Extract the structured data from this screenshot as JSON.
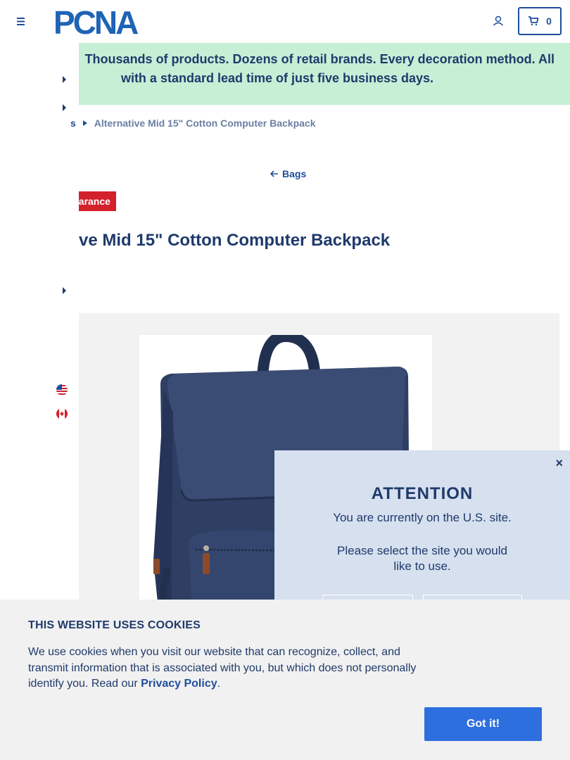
{
  "header": {
    "logo_text": "PCNA",
    "cart_count": "0"
  },
  "banner": {
    "line1": "Thousands of products. Dozens of retail brands. Every decoration method. All",
    "line2": "with a standard lead time of just five business days."
  },
  "breadcrumb": {
    "parent": "s",
    "current": "Alternative Mid 15\" Cotton Computer Backpack"
  },
  "back_link": "Bags",
  "badge": "earance",
  "product": {
    "title": "ve Mid 15\" Cotton Computer Backpack"
  },
  "attention": {
    "close": "×",
    "heading": "ATTENTION",
    "message1": "You are currently on the U.S. site.",
    "message2": "Please select the site you would like to use."
  },
  "cookie": {
    "heading": "THIS WEBSITE USES COOKIES",
    "body": "We use cookies when you visit our website that can recognize, collect, and transmit information that is associated with you, but which does not personally identify you. Read our ",
    "privacy_link": "Privacy Policy",
    "period": ".",
    "button": "Got it!"
  },
  "icons": {
    "menu": "hamburger-menu-icon",
    "account": "user-icon",
    "cart": "cart-icon",
    "back": "arrow-left-icon",
    "breadcrumb_separator": "triangle-right-icon",
    "flag_us": "us-flag-icon",
    "flag_ca": "canada-flag-icon"
  },
  "colors": {
    "primary": "#1f4e9c",
    "text_dark": "#1f3a6b",
    "banner_bg": "#c6efd6",
    "badge_red": "#d3212c",
    "cookie_button": "#2e6fe0",
    "modal_bg": "#d6e0ef"
  }
}
